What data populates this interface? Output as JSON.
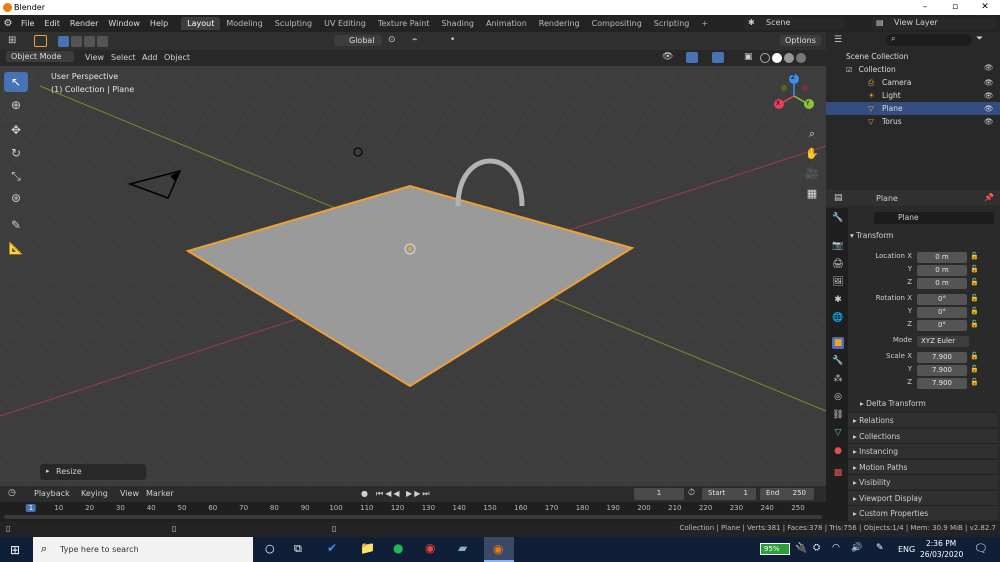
{
  "app": {
    "title": "Blender",
    "accent": "#e87d0d"
  },
  "menu": [
    "File",
    "Edit",
    "Render",
    "Window",
    "Help"
  ],
  "workspaces": [
    "Layout",
    "Modeling",
    "Sculpting",
    "UV Editing",
    "Texture Paint",
    "Shading",
    "Animation",
    "Rendering",
    "Compositing",
    "Scripting"
  ],
  "active_workspace": "Layout",
  "scene": {
    "label": "Scene",
    "view_layer": "View Layer"
  },
  "toolhead": {
    "orientation": "Global",
    "options": "Options"
  },
  "viewport_header": {
    "mode": "Object Mode",
    "menus": [
      "View",
      "Select",
      "Add",
      "Object"
    ]
  },
  "viewport": {
    "perspective": "User Perspective",
    "collection": "(1) Collection | Plane",
    "operator_panel": "Resize"
  },
  "gizmo": {
    "x": "X",
    "y": "Y",
    "z": "Z",
    "colors": {
      "x": "#e8405a",
      "y": "#8bc435",
      "z": "#3c8fe8"
    }
  },
  "outliner": {
    "root": "Scene Collection",
    "collection": "Collection",
    "items": [
      {
        "name": "Camera",
        "icon": "camera-icon"
      },
      {
        "name": "Light",
        "icon": "light-icon"
      },
      {
        "name": "Plane",
        "icon": "mesh-icon",
        "selected": true
      },
      {
        "name": "Torus",
        "icon": "mesh-icon"
      }
    ]
  },
  "properties": {
    "object_name": "Plane",
    "data_name": "Plane",
    "transform_label": "Transform",
    "location_label": "Location X",
    "location": [
      "0 m",
      "0 m",
      "0 m"
    ],
    "rotation_label": "Rotation X",
    "rotation": [
      "0°",
      "0°",
      "0°"
    ],
    "mode_label": "Mode",
    "mode_value": "XYZ Euler",
    "scale_label": "Scale X",
    "scale": [
      "7.900",
      "7.900",
      "7.900"
    ],
    "y": "Y",
    "z": "Z",
    "delta": "Delta Transform",
    "panels": [
      "Relations",
      "Collections",
      "Instancing",
      "Motion Paths",
      "Visibility",
      "Viewport Display",
      "Custom Properties"
    ]
  },
  "timeline": {
    "menus": [
      "Playback",
      "Keying",
      "View",
      "Marker"
    ],
    "current_frame": "1",
    "start_label": "Start",
    "start": "1",
    "end_label": "End",
    "end": "250",
    "ticks": [
      "1",
      "10",
      "20",
      "30",
      "40",
      "50",
      "60",
      "70",
      "80",
      "90",
      "100",
      "110",
      "120",
      "130",
      "140",
      "150",
      "160",
      "170",
      "180",
      "190",
      "200",
      "210",
      "220",
      "230",
      "240",
      "250"
    ]
  },
  "status": {
    "text": "Collection | Plane | Verts:381 | Faces:378 | Tris:756 | Objects:1/4 | Mem: 30.9 MiB | v2.82.7"
  },
  "taskbar": {
    "search": "Type here to search",
    "battery": "95%",
    "lang": "ENG",
    "time": "2:36 PM",
    "date": "26/03/2020"
  }
}
